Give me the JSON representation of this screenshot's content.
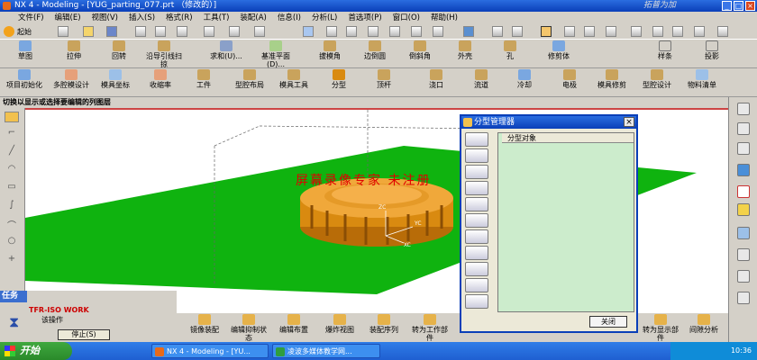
{
  "window": {
    "title": "NX 4 - Modeling - [YUG_parting_077.prt （修改的）]",
    "watermark": "拓普为加"
  },
  "menu": [
    "文件(F)",
    "编辑(E)",
    "视图(V)",
    "插入(S)",
    "格式(R)",
    "工具(T)",
    "装配(A)",
    "信息(I)",
    "分析(L)",
    "首选项(P)",
    "窗口(O)",
    "帮助(H)"
  ],
  "standard_toolbar": {
    "start_label": "起始"
  },
  "feature_toolbar": {
    "items": [
      "草图",
      "拉伸",
      "回转",
      "沿导引线扫掠",
      "求和(U)...",
      "基准平面(D)...",
      "拔模角",
      "边倒圆",
      "倒斜角",
      "外壳",
      "孔",
      "修剪体",
      "样条",
      "投影"
    ]
  },
  "mold_toolbar": {
    "items": [
      "项目初始化",
      "多腔模设计",
      "模具坐标",
      "收缩率",
      "工件",
      "型腔布局",
      "模具工具",
      "分型",
      "顶杆",
      "浇口",
      "流道",
      "冷却",
      "电极",
      "模具修剪",
      "型腔设计",
      "物料清单"
    ]
  },
  "cue_line": "切换以显示或选择要编辑的列图层",
  "overlay_text": "屏幕录像专家  未注册",
  "axis_labels": {
    "zc": "ZC",
    "yc": "YC",
    "xc": "XC"
  },
  "dialog": {
    "title": "分型管理器",
    "column_header": "分型对象",
    "ok_label": "关闭"
  },
  "task_panel": {
    "title": "任务",
    "work_label": "TFR-ISO WORK",
    "status": "该操作",
    "stop_label": "停止(S)"
  },
  "bottom_toolbar": {
    "items": [
      "镜像装配",
      "编辑抑制状态",
      "编辑布置",
      "爆炸视图",
      "装配序列",
      "转为工作部件",
      "转为显示部件",
      "间隙分析"
    ]
  },
  "taskbar": {
    "start": "开始",
    "items": [
      "NX 4 - Modeling - [YU...",
      "凌波多媒体教学网..."
    ],
    "clock": "10:36"
  },
  "colors": {
    "plane": "#0fb30f",
    "part": "#d98a10",
    "title_bar": "#0a3fb8",
    "overlay": "#e00000"
  }
}
